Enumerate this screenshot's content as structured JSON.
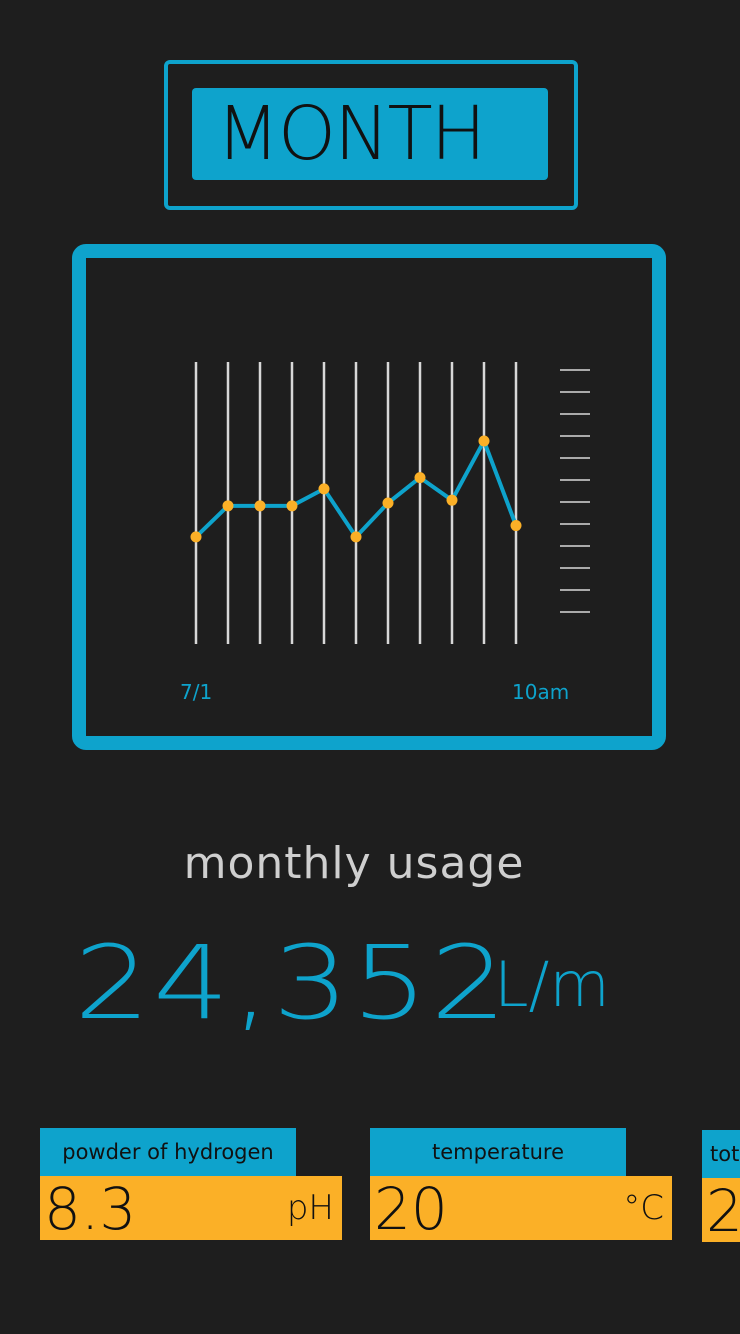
{
  "period_selector": {
    "label": "MONTH"
  },
  "chart_data": {
    "type": "line",
    "x_start_label": "7/1",
    "x_end_label": "10am",
    "values": [
      38,
      49,
      49,
      49,
      55,
      38,
      50,
      59,
      51,
      72,
      42
    ],
    "ylim": [
      0,
      100
    ],
    "y_tick_count": 12,
    "colors": {
      "line": "#0ea3cc",
      "point": "#fbb027",
      "grid": "#d8d8d8"
    }
  },
  "usage": {
    "title": "monthly usage",
    "value": "24,352",
    "unit": "L/m"
  },
  "tiles": [
    {
      "label": "powder of hydrogen",
      "value": "8.3",
      "unit": "pH"
    },
    {
      "label": "temperature",
      "value": "20",
      "unit": "°C"
    },
    {
      "label": "tot",
      "value": "2",
      "unit": ""
    }
  ],
  "colors": {
    "background": "#1e1e1e",
    "accent": "#0ea3cc",
    "highlight": "#fbb027",
    "muted_text": "#cfcfcf"
  }
}
